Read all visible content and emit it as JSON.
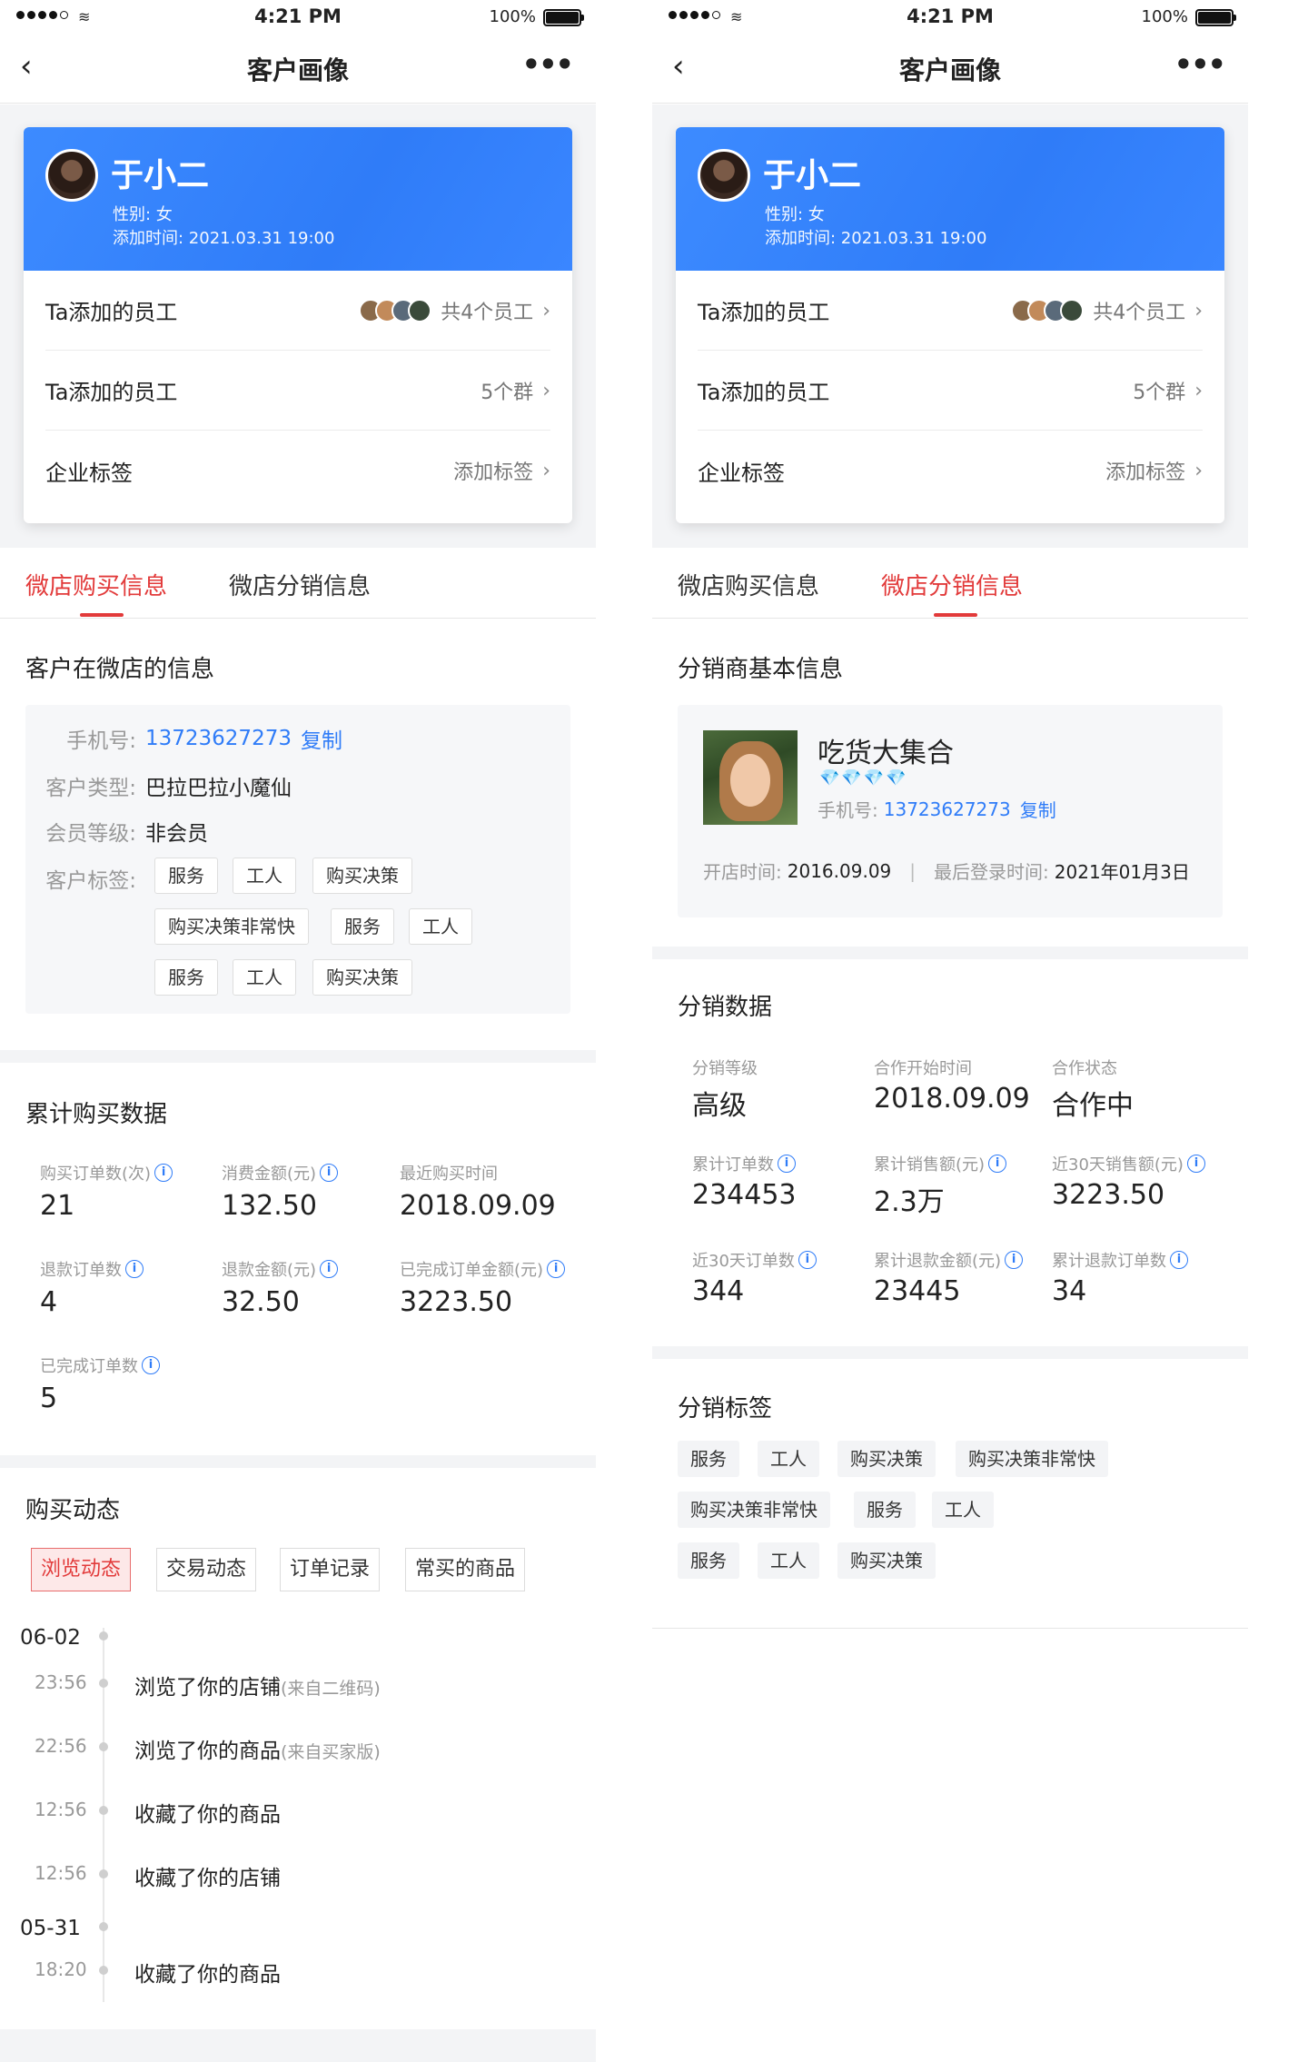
{
  "status_bar": {
    "time": "4:21 PM",
    "battery": "100%"
  },
  "nav": {
    "title": "客户画像",
    "back_icon": "chevron-left-icon",
    "more": "•••"
  },
  "customer": {
    "name": "于小二",
    "sex": "性别: 女",
    "added": "添加时间: 2021.03.31 19:00"
  },
  "card_rows": [
    {
      "label": "Ta添加的员工",
      "value": "共4个员工"
    },
    {
      "label": "Ta添加的员工",
      "value": "5个群"
    },
    {
      "label": "企业标签",
      "value": "添加标签"
    }
  ],
  "tabs": {
    "buy": "微店购买信息",
    "dist": "微店分销信息"
  },
  "colors": {
    "accent": "#e23a3a",
    "brand_blue": "#2f7cf8"
  },
  "left": {
    "shop_info_title": "客户在微店的信息",
    "phone_label": "手机号:",
    "phone": "13723627273",
    "copy": "复制",
    "type_label": "客户类型:",
    "type": "巴拉巴拉小魔仙",
    "level_label": "会员等级:",
    "level": "非会员",
    "tags_label": "客户标签:",
    "tags": [
      "服务",
      "工人",
      "购买决策",
      "购买决策非常快",
      "服务",
      "工人",
      "服务",
      "工人",
      "购买决策"
    ],
    "purchase_title": "累计购买数据",
    "stats": [
      {
        "label": "购买订单数(次)",
        "value": "21",
        "info": true
      },
      {
        "label": "消费金额(元)",
        "value": "132.50",
        "info": true
      },
      {
        "label": "最近购买时间",
        "value": "2018.09.09",
        "info": false
      },
      {
        "label": "退款订单数",
        "value": "4",
        "info": true
      },
      {
        "label": "退款金额(元)",
        "value": "32.50",
        "info": true
      },
      {
        "label": "已完成订单金额(元)",
        "value": "3223.50",
        "info": true
      },
      {
        "label": "已完成订单数",
        "value": "5",
        "info": true
      }
    ],
    "dynamics_title": "购买动态",
    "dyn_buttons": [
      "浏览动态",
      "交易动态",
      "订单记录",
      "常买的商品"
    ],
    "timeline": [
      {
        "date": "06-02"
      },
      {
        "time": "23:56",
        "text": "浏览了你的店铺",
        "sub": "(来自二维码)"
      },
      {
        "time": "22:56",
        "text": "浏览了你的商品",
        "sub": "(来自买家版)"
      },
      {
        "time": "12:56",
        "text": "收藏了你的商品",
        "sub": ""
      },
      {
        "time": "12:56",
        "text": "收藏了你的店铺",
        "sub": ""
      },
      {
        "date": "05-31"
      },
      {
        "time": "18:20",
        "text": "收藏了你的商品",
        "sub": ""
      }
    ]
  },
  "right": {
    "basic_title": "分销商基本信息",
    "store_name": "吃货大集合",
    "diamonds": "💎💎💎💎",
    "phone_label": "手机号:",
    "phone": "13723627273",
    "copy": "复制",
    "open_label": "开店时间:",
    "open_date": "2016.09.09",
    "last_label": "最后登录时间:",
    "last_date": "2021年01月3日",
    "data_title": "分销数据",
    "stats": [
      {
        "label": "分销等级",
        "value": "高级",
        "info": false
      },
      {
        "label": "合作开始时间",
        "value": "2018.09.09",
        "info": false
      },
      {
        "label": "合作状态",
        "value": "合作中",
        "info": false
      },
      {
        "label": "累计订单数",
        "value": "234453",
        "info": true
      },
      {
        "label": "累计销售额(元)",
        "value": "2.3万",
        "info": true
      },
      {
        "label": "近30天销售额(元)",
        "value": "3223.50",
        "info": true
      },
      {
        "label": "近30天订单数",
        "value": "344",
        "info": true
      },
      {
        "label": "累计退款金额(元)",
        "value": "23445",
        "info": true
      },
      {
        "label": "累计退款订单数",
        "value": "34",
        "info": true
      }
    ],
    "tags_title": "分销标签",
    "tags": [
      "服务",
      "工人",
      "购买决策",
      "购买决策非常快",
      "购买决策非常快",
      "服务",
      "工人",
      "服务",
      "工人",
      "购买决策"
    ]
  }
}
